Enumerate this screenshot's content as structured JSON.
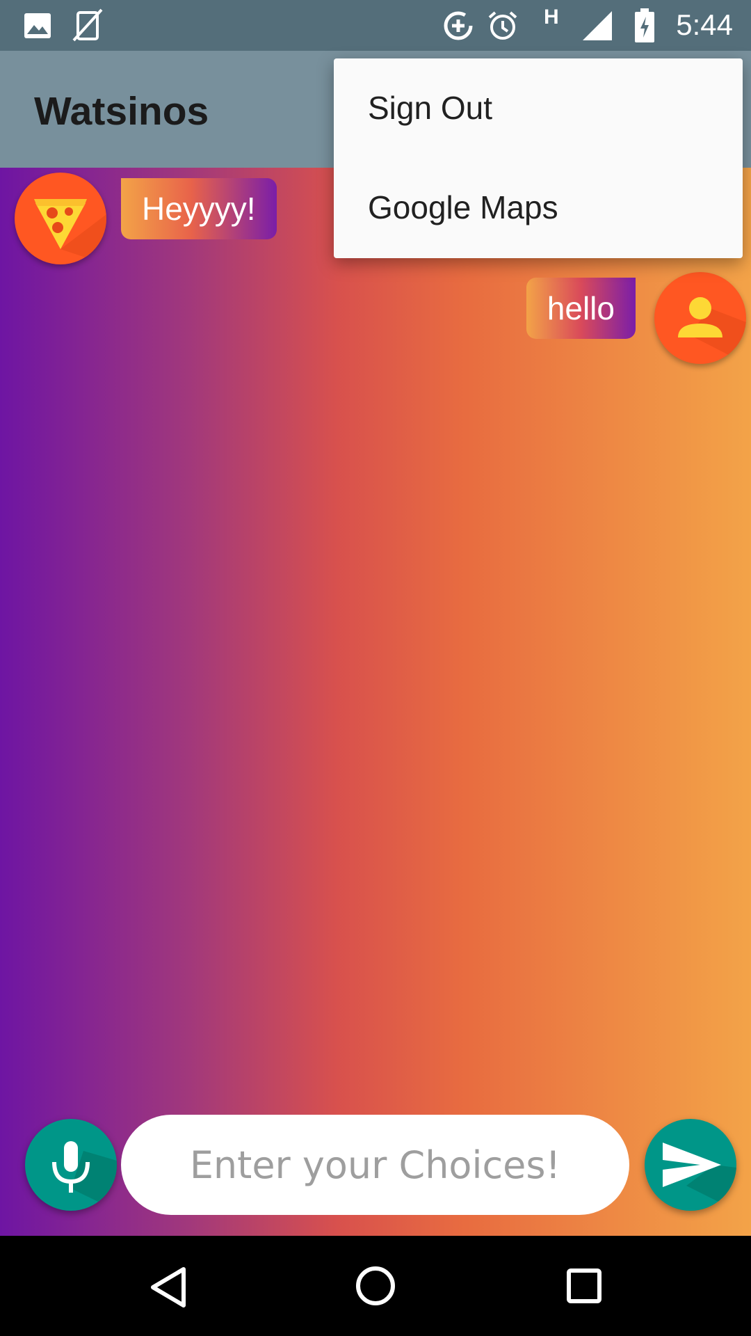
{
  "status_bar": {
    "time": "5:44",
    "network_label": "H",
    "icons": [
      "image-icon",
      "screen-rotation-off-icon",
      "data-saver-icon",
      "alarm-icon",
      "network-type-icon",
      "signal-icon",
      "battery-charging-icon"
    ]
  },
  "app_bar": {
    "title": "Watsinos"
  },
  "overflow_menu": {
    "items": [
      {
        "label": "Sign Out"
      },
      {
        "label": "Google Maps"
      }
    ]
  },
  "messages": [
    {
      "sender": "bot",
      "text": "Heyyyy!",
      "avatar_icon": "pizza-icon"
    },
    {
      "sender": "user",
      "text": "hello",
      "avatar_icon": "person-icon"
    }
  ],
  "composer": {
    "placeholder": "Enter your Choices!",
    "value": "",
    "mic_icon": "microphone-icon",
    "send_icon": "send-icon"
  },
  "nav_bar": {
    "icons": [
      "back-icon",
      "home-icon",
      "recents-icon"
    ]
  },
  "colors": {
    "status_bar": "#546E7A",
    "app_bar": "#78909C",
    "avatar": "#FF5722",
    "fab": "#009688",
    "gradient_left": "#6E15A3",
    "gradient_right": "#F3A348"
  }
}
